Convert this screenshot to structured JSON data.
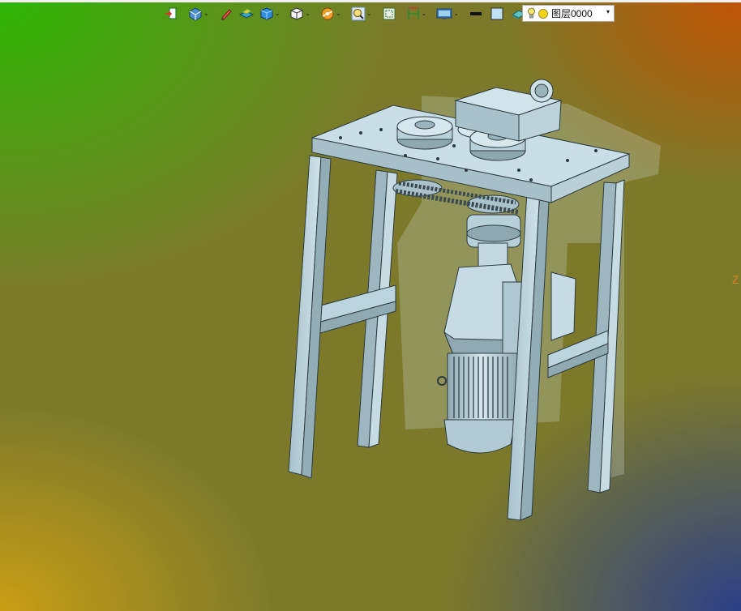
{
  "toolbar": {
    "items": [
      {
        "icon": "exit-sketch-icon",
        "dropdown": false
      },
      {
        "icon": "view-orientation-icon",
        "dropdown": true
      },
      {
        "icon": "pen-sketch-icon",
        "dropdown": false
      },
      {
        "icon": "extrude-icon",
        "dropdown": false
      },
      {
        "icon": "solid-box-icon",
        "dropdown": true
      },
      {
        "icon": "cube-display-icon",
        "dropdown": true
      },
      {
        "icon": "section-view-icon",
        "dropdown": true
      },
      {
        "icon": "zoom-icon",
        "dropdown": true
      },
      {
        "icon": "zoom-fit-icon",
        "dropdown": false
      },
      {
        "icon": "dimension-icon",
        "dropdown": true
      },
      {
        "icon": "render-mode-icon",
        "dropdown": true
      },
      {
        "icon": "line-color-icon",
        "dropdown": false
      },
      {
        "icon": "fill-color-icon",
        "dropdown": false
      },
      {
        "icon": "material-icon",
        "dropdown": true
      }
    ],
    "dropdown_glyph": "⌄"
  },
  "layer": {
    "label": "图层0000",
    "caret": "▾",
    "bulb_color": "#f5e56b",
    "sun_color": "#f7d21a"
  },
  "axis": {
    "label": "Z"
  },
  "colors": {
    "model_steel": "#b8d0da",
    "model_edge": "#2c3a40",
    "bg_green": "#28b900",
    "bg_orange": "#c85000",
    "bg_blue": "#283c8c",
    "bg_yellow": "#cda014"
  }
}
